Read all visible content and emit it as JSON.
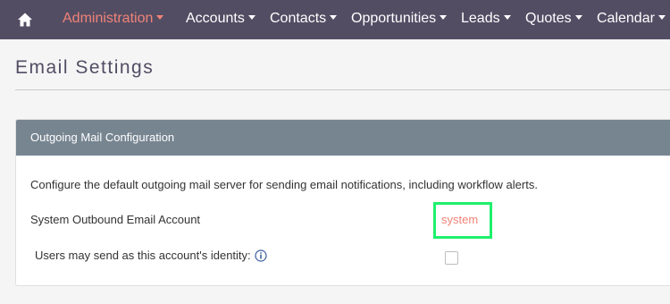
{
  "nav": {
    "home_icon": "home-icon",
    "items": [
      {
        "label": "Administration",
        "active": true
      },
      {
        "label": "Accounts",
        "active": false
      },
      {
        "label": "Contacts",
        "active": false
      },
      {
        "label": "Opportunities",
        "active": false
      },
      {
        "label": "Leads",
        "active": false
      },
      {
        "label": "Quotes",
        "active": false
      },
      {
        "label": "Calendar",
        "active": false
      }
    ]
  },
  "page": {
    "title": "Email Settings"
  },
  "panel": {
    "header": "Outgoing Mail Configuration",
    "description": "Configure the default outgoing mail server for sending email notifications, including workflow alerts.",
    "outbound_label": "System Outbound Email Account",
    "outbound_value": "system",
    "send_as_label": "Users may send as this account's identity:",
    "send_as_checked": false,
    "info_icon": "info-icon"
  },
  "colors": {
    "nav_bg": "#534d64",
    "active_link": "#f08377",
    "panel_header_bg": "#778591",
    "highlight": "#1ef06c"
  }
}
